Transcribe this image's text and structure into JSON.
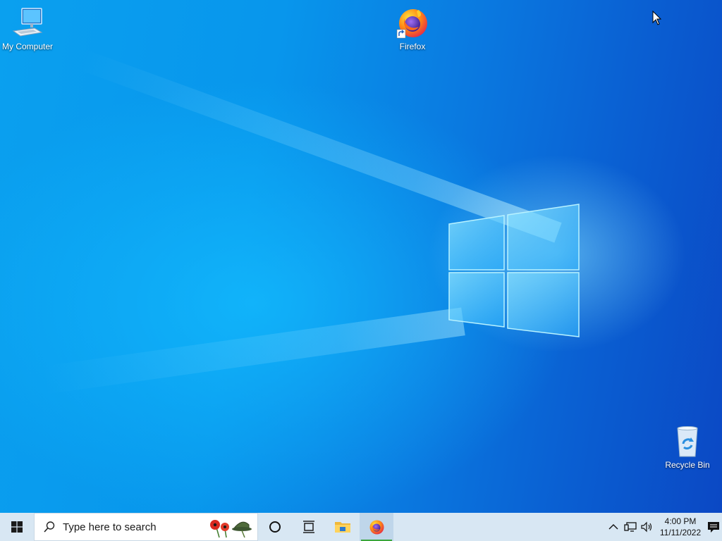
{
  "desktop": {
    "icons": [
      {
        "label": "My Computer",
        "icon": "computer-icon"
      },
      {
        "label": "Firefox",
        "icon": "firefox-icon"
      },
      {
        "label": "Recycle Bin",
        "icon": "recycle-bin-icon"
      }
    ],
    "wallpaper": {
      "base_color": "#0a86e6",
      "glow_color": "#7fe0ff"
    }
  },
  "taskbar": {
    "background": "#d8e7f3",
    "start_icon": "windows-logo-icon",
    "search": {
      "placeholder": "Type here to search",
      "highlight_icon": "poppy-helmet-icon"
    },
    "task_view_icon": "task-view-icon",
    "cortana_icon": "cortana-circle-icon",
    "pinned": [
      {
        "name": "File Explorer",
        "icon": "folder-icon",
        "active": false
      },
      {
        "name": "Firefox",
        "icon": "firefox-icon",
        "active": true
      }
    ],
    "tray": {
      "icons": [
        "chevron-up-icon",
        "network-icon",
        "volume-icon"
      ],
      "time": "4:00 PM",
      "date": "11/11/2022",
      "notification_count": "1"
    }
  }
}
